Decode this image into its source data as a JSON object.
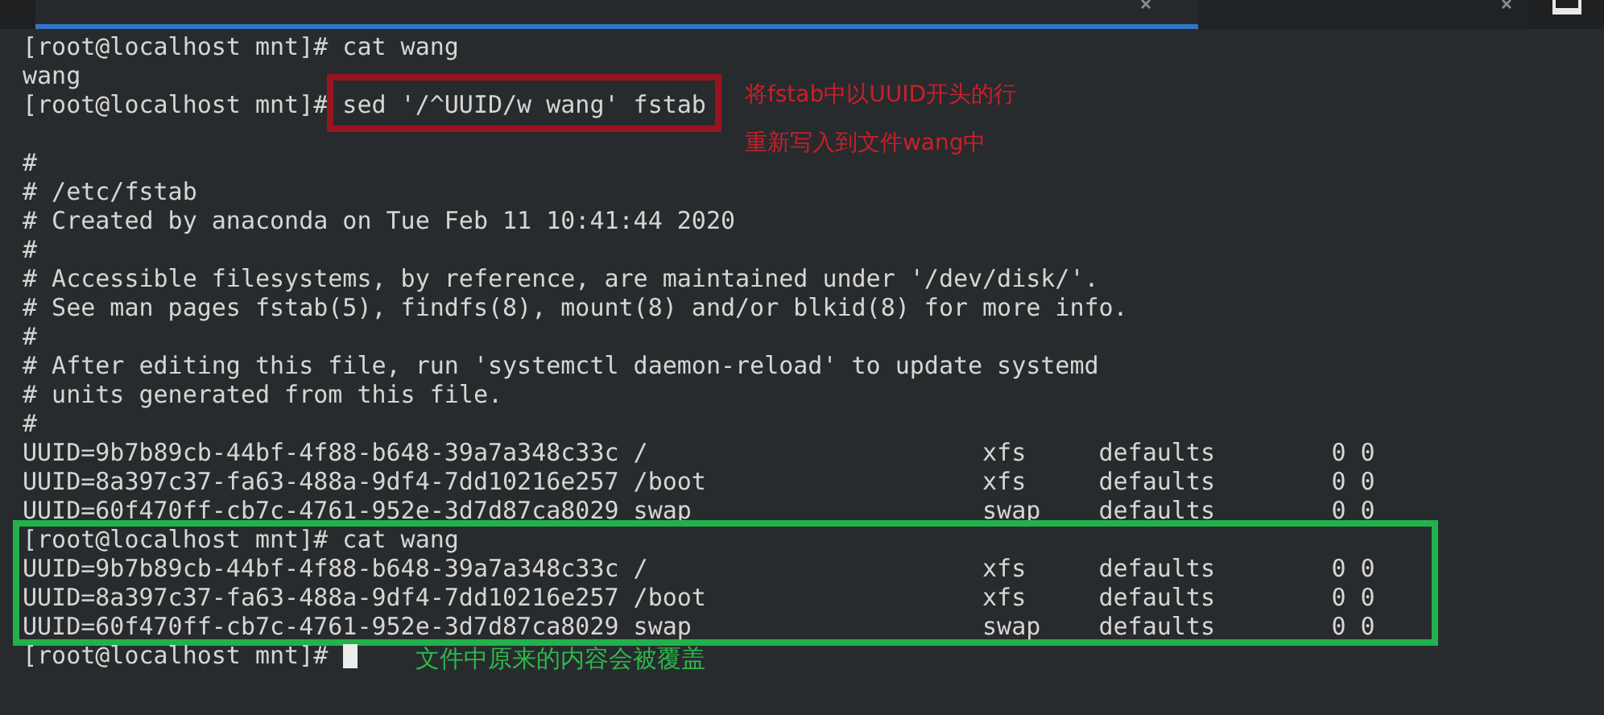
{
  "tabs": [
    {
      "selected": true
    },
    {
      "selected": false
    }
  ],
  "terminal": {
    "lines": [
      {
        "kind": "prompt",
        "prompt": "[root@localhost mnt]#",
        "command": "cat wang",
        "highlighted": false,
        "cursor": false,
        "boxed": false
      },
      {
        "kind": "output",
        "text": "wang",
        "boxed": false
      },
      {
        "kind": "prompt",
        "prompt": "[root@localhost mnt]#",
        "command": "sed '/^UUID/w wang' fstab",
        "highlighted": true,
        "cursor": false,
        "boxed": false
      },
      {
        "kind": "blank",
        "boxed": false
      },
      {
        "kind": "output",
        "text": "#",
        "boxed": false
      },
      {
        "kind": "output",
        "text": "# /etc/fstab",
        "boxed": false
      },
      {
        "kind": "output",
        "text": "# Created by anaconda on Tue Feb 11 10:41:44 2020",
        "boxed": false
      },
      {
        "kind": "output",
        "text": "#",
        "boxed": false
      },
      {
        "kind": "output",
        "text": "# Accessible filesystems, by reference, are maintained under '/dev/disk/'.",
        "boxed": false
      },
      {
        "kind": "output",
        "text": "# See man pages fstab(5), findfs(8), mount(8) and/or blkid(8) for more info.",
        "boxed": false
      },
      {
        "kind": "output",
        "text": "#",
        "boxed": false
      },
      {
        "kind": "output",
        "text": "# After editing this file, run 'systemctl daemon-reload' to update systemd",
        "boxed": false
      },
      {
        "kind": "output",
        "text": "# units generated from this file.",
        "boxed": false
      },
      {
        "kind": "output",
        "text": "#",
        "boxed": false
      },
      {
        "kind": "fstab",
        "cells": [
          "UUID=9b7b89cb-44bf-4f88-b648-39a7a348c33c /",
          "xfs",
          "defaults",
          "0 0"
        ],
        "boxed": false
      },
      {
        "kind": "fstab",
        "cells": [
          "UUID=8a397c37-fa63-488a-9df4-7dd10216e257 /boot",
          "xfs",
          "defaults",
          "0 0"
        ],
        "boxed": false
      },
      {
        "kind": "fstab",
        "cells": [
          "UUID=60f470ff-cb7c-4761-952e-3d7d87ca8029 swap",
          "swap",
          "defaults",
          "0 0"
        ],
        "boxed": false
      },
      {
        "kind": "prompt",
        "prompt": "[root@localhost mnt]#",
        "command": "cat wang",
        "highlighted": false,
        "cursor": false,
        "boxed": true
      },
      {
        "kind": "fstab",
        "cells": [
          "UUID=9b7b89cb-44bf-4f88-b648-39a7a348c33c /",
          "xfs",
          "defaults",
          "0 0"
        ],
        "boxed": true
      },
      {
        "kind": "fstab",
        "cells": [
          "UUID=8a397c37-fa63-488a-9df4-7dd10216e257 /boot",
          "xfs",
          "defaults",
          "0 0"
        ],
        "boxed": true
      },
      {
        "kind": "fstab",
        "cells": [
          "UUID=60f470ff-cb7c-4761-952e-3d7d87ca8029 swap",
          "swap",
          "defaults",
          "0 0"
        ],
        "boxed": true
      },
      {
        "kind": "prompt",
        "prompt": "[root@localhost mnt]#",
        "highlighted": false,
        "cursor": true,
        "boxed": false
      }
    ]
  },
  "annotations": [
    {
      "kind": "command-note",
      "lines": [
        "将fstab中以UUID开头的行",
        "重新写入到文件wang中"
      ]
    },
    {
      "kind": "block-note",
      "lines": [
        "文件中原来的内容会被覆盖"
      ]
    }
  ]
}
